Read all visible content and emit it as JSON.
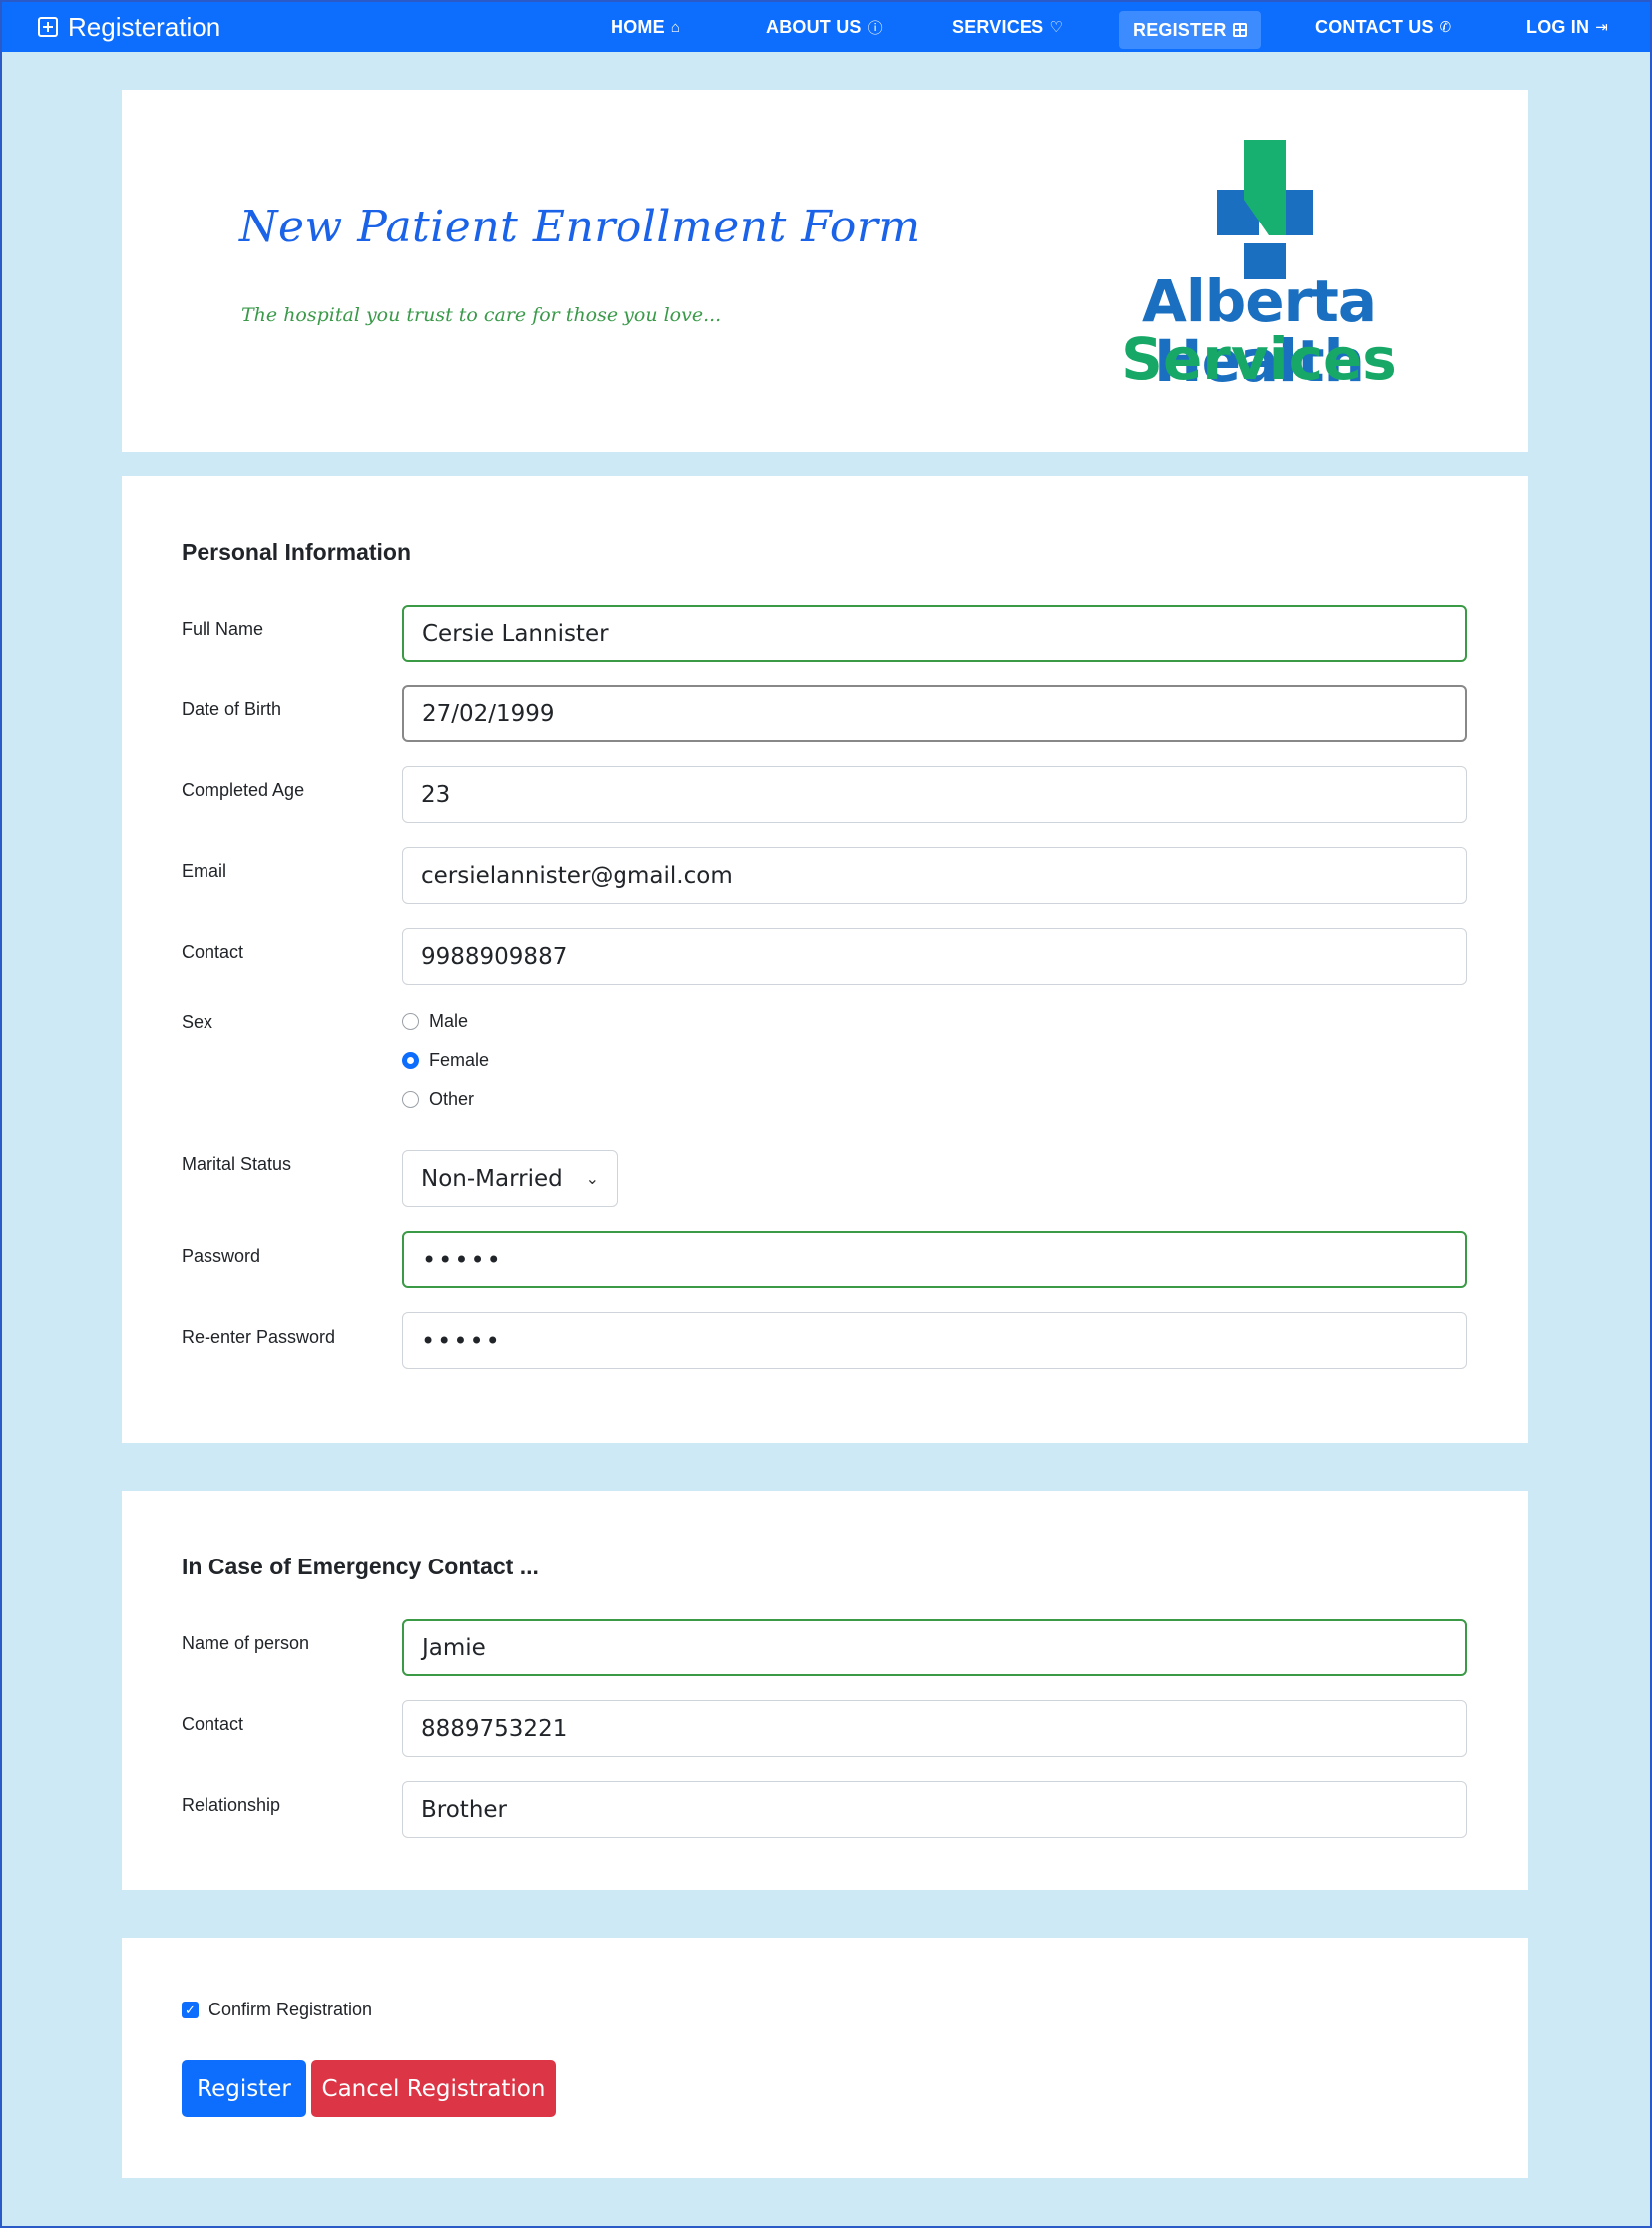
{
  "nav": {
    "brand": "Registeration",
    "items": [
      {
        "label": "HOME",
        "glyph": "⌂"
      },
      {
        "label": "ABOUT US",
        "glyph": "ⓘ"
      },
      {
        "label": "SERVICES",
        "glyph": "♡"
      },
      {
        "label": "REGISTER",
        "glyph": ""
      },
      {
        "label": "CONTACT US",
        "glyph": "✆"
      },
      {
        "label": "LOG IN",
        "glyph": "⇥"
      }
    ],
    "active": "REGISTER",
    "color": "#0d6efd"
  },
  "header": {
    "title": "New Patient Enrollment Form",
    "tagline": "The hospital you trust to care for those you love...",
    "logo_line1": "Alberta Health",
    "logo_line2": "Services"
  },
  "personal": {
    "section_title": "Personal Information",
    "full_name": {
      "label": "Full Name",
      "value": "Cersie Lannister"
    },
    "dob": {
      "label": "Date of Birth",
      "value": "27/02/1999"
    },
    "age": {
      "label": "Completed Age",
      "value": "23"
    },
    "email": {
      "label": "Email",
      "value": "cersielannister@gmail.com"
    },
    "contact": {
      "label": "Contact",
      "value": "9988909887"
    },
    "sex": {
      "label": "Sex",
      "options": [
        "Male",
        "Female",
        "Other"
      ],
      "selected": "Female"
    },
    "marital": {
      "label": "Marital Status",
      "value": "Non-Married"
    },
    "password": {
      "label": "Password",
      "value": "•••••"
    },
    "password2": {
      "label": "Re-enter Password",
      "value": "•••••"
    }
  },
  "emergency": {
    "section_title": "In Case of Emergency Contact ...",
    "name": {
      "label": "Name of person",
      "value": "Jamie"
    },
    "contact": {
      "label": "Contact",
      "value": "8889753221"
    },
    "relationship": {
      "label": "Relationship",
      "value": "Brother"
    }
  },
  "confirm": {
    "checkbox_label": "Confirm Registration",
    "checked": true,
    "register_label": "Register",
    "cancel_label": "Cancel Registration"
  }
}
